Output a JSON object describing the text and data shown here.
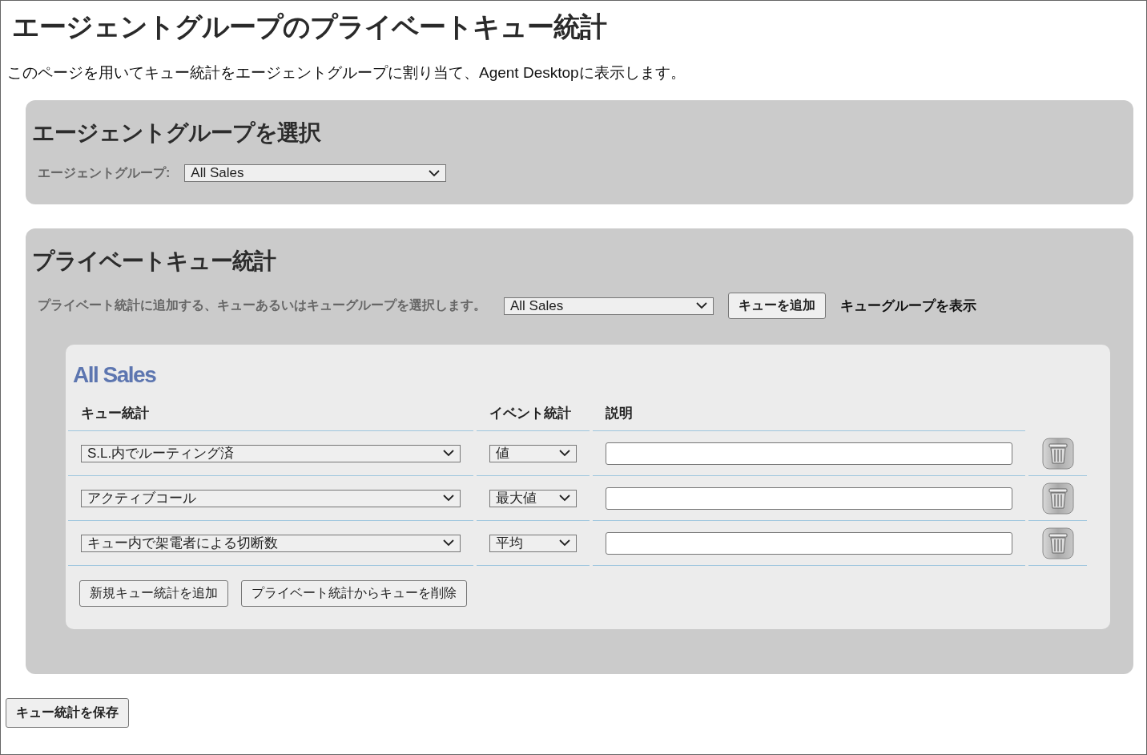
{
  "title": "エージェントグループのプライベートキュー統計",
  "description": "このページを用いてキュー統計をエージェントグループに割り当て、Agent Desktopに表示します。",
  "group_section": {
    "heading": "エージェントグループを選択",
    "label": "エージェントグループ:",
    "value": "All Sales"
  },
  "private_section": {
    "heading": "プライベートキュー統計",
    "prompt": "プライベート統計に追加する、キューあるいはキューグループを選択します。",
    "queue_value": "All Sales",
    "add_button": "キューを追加",
    "show_link": "キューグループを表示",
    "queue_panel": {
      "title": "All Sales",
      "columns": [
        "キュー統計",
        "イベント統計",
        "説明"
      ],
      "rows": [
        {
          "statistic": "S.L.内でルーティング済",
          "event": "値",
          "description": ""
        },
        {
          "statistic": "アクティブコール",
          "event": "最大値",
          "description": ""
        },
        {
          "statistic": "キュー内で架電者による切断数",
          "event": "平均",
          "description": ""
        }
      ],
      "buttons": [
        "新規キュー統計を追加",
        "プライベート統計からキューを削除"
      ]
    }
  },
  "save_button": "キュー統計を保存"
}
